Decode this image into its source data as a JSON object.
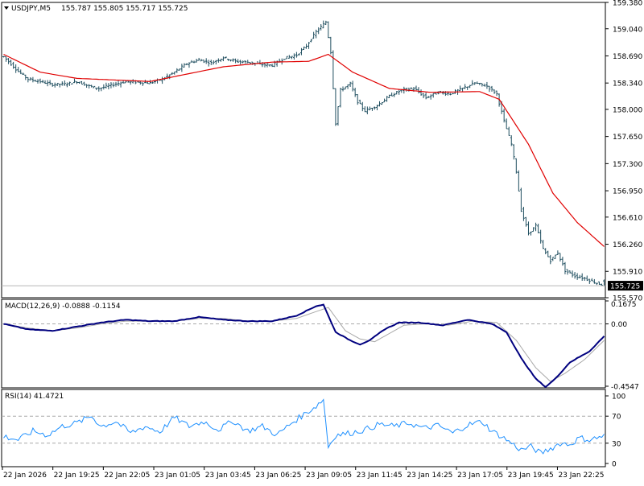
{
  "chart_data": [
    {
      "type": "ohlc",
      "title": "USDJPY,M5",
      "ohlc_readout": [
        "155.787",
        "155.805",
        "155.717",
        "155.725"
      ],
      "current_price_label": "155.725",
      "current_price": 155.725,
      "ylim": [
        155.57,
        159.38
      ],
      "y_ticks": [
        "159.380",
        "159.040",
        "158.690",
        "158.340",
        "158.000",
        "157.650",
        "157.300",
        "156.950",
        "156.610",
        "156.260",
        "155.910",
        "155.570"
      ],
      "x_ticks": [
        "22 Jan 2026",
        "22 Jan 19:25",
        "22 Jan 22:05",
        "23 Jan 01:05",
        "23 Jan 03:45",
        "23 Jan 06:25",
        "23 Jan 09:05",
        "23 Jan 11:45",
        "23 Jan 14:25",
        "23 Jan 17:05",
        "23 Jan 19:45",
        "23 Jan 22:25"
      ],
      "anchors": [
        [
          0,
          158.68
        ],
        [
          6,
          158.49
        ],
        [
          10,
          158.39
        ],
        [
          15,
          158.36
        ],
        [
          20,
          158.32
        ],
        [
          26,
          158.33
        ],
        [
          30,
          158.36
        ],
        [
          35,
          158.3
        ],
        [
          39,
          158.27
        ],
        [
          45,
          158.32
        ],
        [
          50,
          158.36
        ],
        [
          55,
          158.35
        ],
        [
          60,
          158.34
        ],
        [
          65,
          158.39
        ],
        [
          70,
          158.48
        ],
        [
          75,
          158.59
        ],
        [
          80,
          158.64
        ],
        [
          85,
          158.6
        ],
        [
          90,
          158.67
        ],
        [
          95,
          158.62
        ],
        [
          100,
          158.61
        ],
        [
          105,
          158.58
        ],
        [
          110,
          158.57
        ],
        [
          115,
          158.66
        ],
        [
          120,
          158.7
        ],
        [
          124,
          158.82
        ],
        [
          128,
          159.0
        ],
        [
          132,
          159.13
        ],
        [
          134,
          158.74
        ],
        [
          136,
          157.82
        ],
        [
          138,
          158.25
        ],
        [
          142,
          158.33
        ],
        [
          145,
          158.1
        ],
        [
          148,
          157.98
        ],
        [
          153,
          158.05
        ],
        [
          158,
          158.17
        ],
        [
          163,
          158.25
        ],
        [
          168,
          158.27
        ],
        [
          173,
          158.15
        ],
        [
          178,
          158.22
        ],
        [
          183,
          158.2
        ],
        [
          188,
          158.27
        ],
        [
          193,
          158.34
        ],
        [
          198,
          158.3
        ],
        [
          202,
          158.2
        ],
        [
          205,
          157.85
        ],
        [
          208,
          157.55
        ],
        [
          210,
          157.2
        ],
        [
          212,
          156.7
        ],
        [
          215,
          156.4
        ],
        [
          218,
          156.5
        ],
        [
          221,
          156.2
        ],
        [
          224,
          156.05
        ],
        [
          227,
          156.15
        ],
        [
          230,
          155.92
        ],
        [
          234,
          155.85
        ],
        [
          238,
          155.82
        ],
        [
          242,
          155.77
        ],
        [
          246,
          155.73
        ]
      ],
      "ma_anchors": [
        [
          0,
          158.71
        ],
        [
          15,
          158.48
        ],
        [
          30,
          158.4
        ],
        [
          60,
          158.36
        ],
        [
          90,
          158.55
        ],
        [
          110,
          158.61
        ],
        [
          125,
          158.62
        ],
        [
          133,
          158.71
        ],
        [
          143,
          158.48
        ],
        [
          158,
          158.27
        ],
        [
          175,
          158.22
        ],
        [
          195,
          158.23
        ],
        [
          203,
          158.13
        ],
        [
          215,
          157.55
        ],
        [
          225,
          156.92
        ],
        [
          235,
          156.54
        ],
        [
          246,
          156.23
        ]
      ],
      "candle_count": 247
    },
    {
      "type": "line",
      "title": "MACD(12,26,9) -0.0888 -0.1154",
      "ylim": [
        -0.4547,
        0.1675
      ],
      "y_ticks": [
        "0.1675",
        "0.00",
        "-0.4547"
      ],
      "main_anchors": [
        [
          0,
          0.0
        ],
        [
          10,
          -0.04
        ],
        [
          20,
          -0.05
        ],
        [
          30,
          -0.02
        ],
        [
          40,
          0.01
        ],
        [
          50,
          0.03
        ],
        [
          60,
          0.02
        ],
        [
          70,
          0.02
        ],
        [
          80,
          0.05
        ],
        [
          90,
          0.03
        ],
        [
          100,
          0.02
        ],
        [
          110,
          0.02
        ],
        [
          120,
          0.06
        ],
        [
          128,
          0.13
        ],
        [
          131,
          0.14
        ],
        [
          136,
          -0.06
        ],
        [
          142,
          -0.12
        ],
        [
          146,
          -0.15
        ],
        [
          150,
          -0.12
        ],
        [
          156,
          -0.04
        ],
        [
          162,
          0.01
        ],
        [
          170,
          0.01
        ],
        [
          180,
          -0.01
        ],
        [
          190,
          0.03
        ],
        [
          200,
          0.0
        ],
        [
          206,
          -0.06
        ],
        [
          212,
          -0.25
        ],
        [
          218,
          -0.4
        ],
        [
          222,
          -0.46
        ],
        [
          226,
          -0.4
        ],
        [
          232,
          -0.28
        ],
        [
          240,
          -0.2
        ],
        [
          246,
          -0.09
        ]
      ],
      "signal_anchors": [
        [
          0,
          0.0
        ],
        [
          10,
          -0.03
        ],
        [
          20,
          -0.05
        ],
        [
          30,
          -0.03
        ],
        [
          40,
          0.0
        ],
        [
          50,
          0.02
        ],
        [
          60,
          0.02
        ],
        [
          70,
          0.02
        ],
        [
          80,
          0.04
        ],
        [
          90,
          0.04
        ],
        [
          100,
          0.02
        ],
        [
          110,
          0.02
        ],
        [
          120,
          0.04
        ],
        [
          128,
          0.09
        ],
        [
          133,
          0.12
        ],
        [
          140,
          -0.05
        ],
        [
          146,
          -0.11
        ],
        [
          152,
          -0.13
        ],
        [
          158,
          -0.07
        ],
        [
          164,
          -0.01
        ],
        [
          172,
          0.0
        ],
        [
          182,
          -0.01
        ],
        [
          192,
          0.02
        ],
        [
          202,
          0.01
        ],
        [
          210,
          -0.12
        ],
        [
          218,
          -0.32
        ],
        [
          224,
          -0.42
        ],
        [
          230,
          -0.36
        ],
        [
          238,
          -0.26
        ],
        [
          246,
          -0.12
        ]
      ]
    },
    {
      "type": "line",
      "title": "RSI(14) 41.4721",
      "ylim": [
        0,
        100
      ],
      "y_ticks": [
        "100",
        "70",
        "30",
        "0"
      ],
      "levels": [
        70,
        30
      ],
      "anchors": [
        [
          0,
          40
        ],
        [
          6,
          35
        ],
        [
          12,
          48
        ],
        [
          18,
          42
        ],
        [
          24,
          55
        ],
        [
          30,
          60
        ],
        [
          36,
          70
        ],
        [
          40,
          55
        ],
        [
          46,
          62
        ],
        [
          52,
          45
        ],
        [
          58,
          55
        ],
        [
          64,
          47
        ],
        [
          70,
          68
        ],
        [
          76,
          55
        ],
        [
          82,
          62
        ],
        [
          88,
          50
        ],
        [
          94,
          63
        ],
        [
          100,
          48
        ],
        [
          106,
          55
        ],
        [
          112,
          42
        ],
        [
          118,
          60
        ],
        [
          124,
          75
        ],
        [
          128,
          85
        ],
        [
          131,
          95
        ],
        [
          133,
          25
        ],
        [
          136,
          42
        ],
        [
          142,
          45
        ],
        [
          148,
          50
        ],
        [
          154,
          58
        ],
        [
          160,
          55
        ],
        [
          166,
          60
        ],
        [
          172,
          52
        ],
        [
          178,
          56
        ],
        [
          184,
          45
        ],
        [
          190,
          57
        ],
        [
          196,
          62
        ],
        [
          200,
          48
        ],
        [
          204,
          40
        ],
        [
          208,
          30
        ],
        [
          212,
          20
        ],
        [
          216,
          25
        ],
        [
          220,
          15
        ],
        [
          224,
          22
        ],
        [
          228,
          30
        ],
        [
          232,
          28
        ],
        [
          236,
          38
        ],
        [
          240,
          35
        ],
        [
          246,
          41
        ]
      ]
    }
  ],
  "colors": {
    "candle": "#1f4e5f",
    "moving_average": "#e00000",
    "macd_main": "#00007f",
    "macd_signal": "#a8a8a8",
    "rsi": "#1e90ff",
    "dashed_level": "#a8a8a8",
    "border": "#000000",
    "price_label_bg": "#000000",
    "price_label_text": "#ffffff"
  }
}
